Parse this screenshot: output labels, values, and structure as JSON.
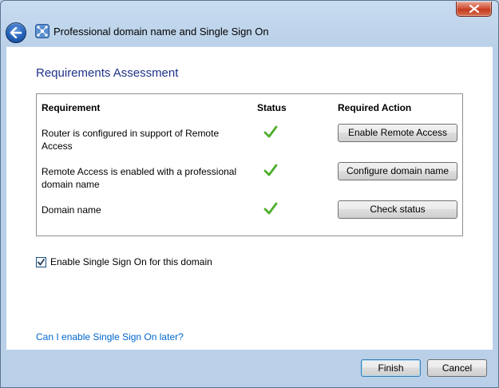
{
  "window": {
    "title": "Professional domain name and Single Sign On"
  },
  "icons": {
    "close": "close-icon",
    "back": "back-arrow-icon",
    "title": "network-hub-icon",
    "status_ok": "checkmark-icon",
    "checkbox": "checkbox-checked-icon"
  },
  "colors": {
    "heading": "#1e3287",
    "link": "#0066cc",
    "check": "#4fae2c",
    "close_button": "#c43a1f"
  },
  "section": {
    "heading": "Requirements Assessment"
  },
  "table": {
    "headers": {
      "requirement": "Requirement",
      "status": "Status",
      "action": "Required Action"
    },
    "rows": [
      {
        "requirement": "Router is configured in support of Remote Access",
        "status": "ok",
        "action": "Enable Remote Access"
      },
      {
        "requirement": "Remote Access is enabled with a professional domain name",
        "status": "ok",
        "action": "Configure domain name"
      },
      {
        "requirement": "Domain name",
        "status": "ok",
        "action": "Check status"
      }
    ]
  },
  "sso": {
    "label": "Enable Single Sign On for this domain",
    "checked": true
  },
  "help_link": "Can I enable Single Sign On later?",
  "footer": {
    "finish": "Finish",
    "cancel": "Cancel"
  }
}
